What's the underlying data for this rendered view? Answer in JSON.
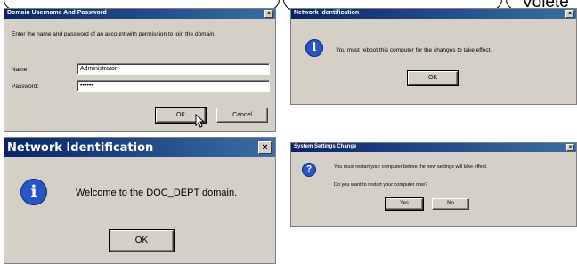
{
  "top_tabs": [
    {
      "label": ""
    },
    {
      "label": ""
    },
    {
      "label": "Volete"
    }
  ],
  "dialog_credentials": {
    "title": "Domain Username And Password",
    "description": "Enter the name and password of an account with permission to join the domain.",
    "name_label": "Name:",
    "name_value": "Administrator",
    "password_label": "Password:",
    "password_value": "••••••",
    "ok_label": "OK",
    "cancel_label": "Cancel",
    "close_glyph": "×"
  },
  "dialog_reboot": {
    "title": "Network Identification",
    "message": "You must reboot this computer for the changes to take effect.",
    "ok_label": "OK",
    "close_glyph": "×"
  },
  "dialog_welcome": {
    "title": "Network Identification",
    "message": "Welcome to the DOC_DEPT domain.",
    "ok_label": "OK",
    "close_glyph": "×"
  },
  "dialog_restart": {
    "title": "System Settings Change",
    "message_line1": "You must restart your computer before the new settings will take effect.",
    "message_line2": "Do you want to restart your computer now?",
    "yes_label": "Yes",
    "no_label": "No",
    "close_glyph": "×"
  },
  "icons": {
    "info": "info-icon",
    "question": "question-icon",
    "close": "close-icon",
    "cursor": "mouse-pointer-icon"
  },
  "colors": {
    "title_bar_start": "#0a246a",
    "title_bar_end": "#3a6ea5",
    "dialog_face": "#d4d0c8"
  }
}
